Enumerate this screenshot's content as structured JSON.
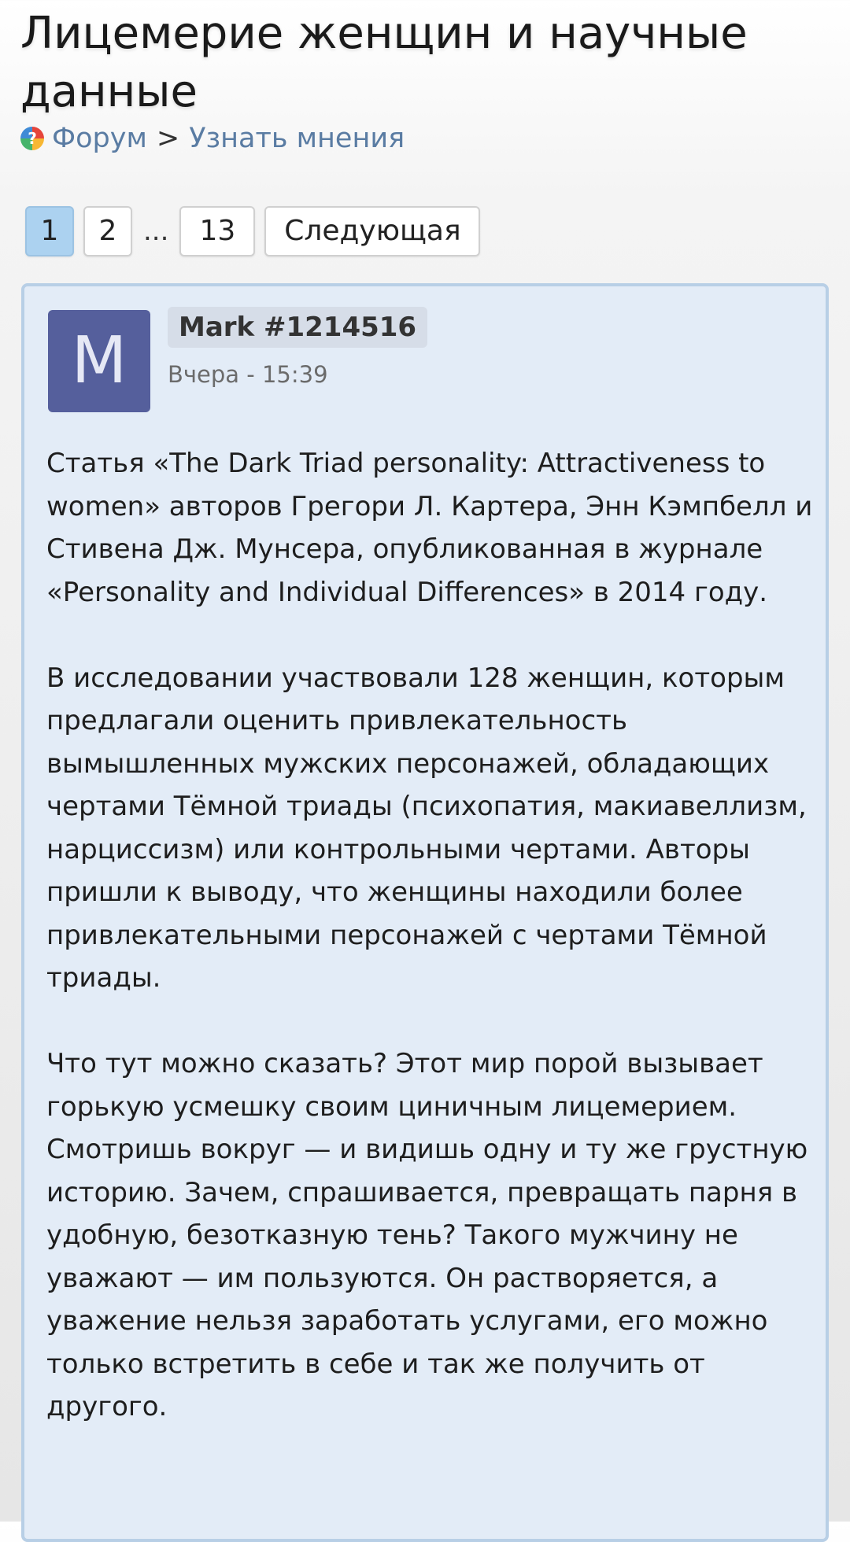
{
  "header": {
    "title": "Лицемерие женщин и научные данные"
  },
  "breadcrumb": {
    "icon": "forum-icon",
    "forum_label": "Форум",
    "separator": ">",
    "section_label": "Узнать мнения"
  },
  "pagination": {
    "pages": [
      "1",
      "2",
      "13"
    ],
    "current": "1",
    "ellipsis": "...",
    "next_label": "Следующая"
  },
  "post": {
    "avatar_letter": "M",
    "avatar_color": "#555f9c",
    "author": "Mark #1214516",
    "time": "Вчера - 15:39",
    "body": "Статья «The Dark Triad personality: Attractiveness to women» авторов Грегори Л. Картера, Энн Кэмпбелл и Стивена Дж. Мунсера, опубликованная в журнале «Personality and Individual Differences» в 2014 году.\n\nВ исследовании участвовали 128 женщин, которым предлагали оценить привлекательность вымышленных мужских персонажей, обладающих чертами Тёмной триады (психопатия, макиавеллизм, нарциссизм) или контрольными чертами. Авторы пришли к выводу, что женщины находили более привлекательными персонажей с чертами Тёмной триады.\n\nЧто тут можно сказать? Этот мир порой вызывает горькую усмешку своим циничным лицемерием. Смотришь вокруг — и видишь одну и ту же грустную историю. Зачем, спрашивается, превращать парня в удобную, безотказную тень? Такого мужчину не уважают — им пользуются. Он растворяется, а уважение нельзя заработать услугами, его можно только встретить в себе и так же получить от другого."
  },
  "colors": {
    "active_page": "#acd2f0",
    "post_background": "#e3ecf7",
    "post_border": "#b8cfe6",
    "link": "#5a7ca3"
  }
}
